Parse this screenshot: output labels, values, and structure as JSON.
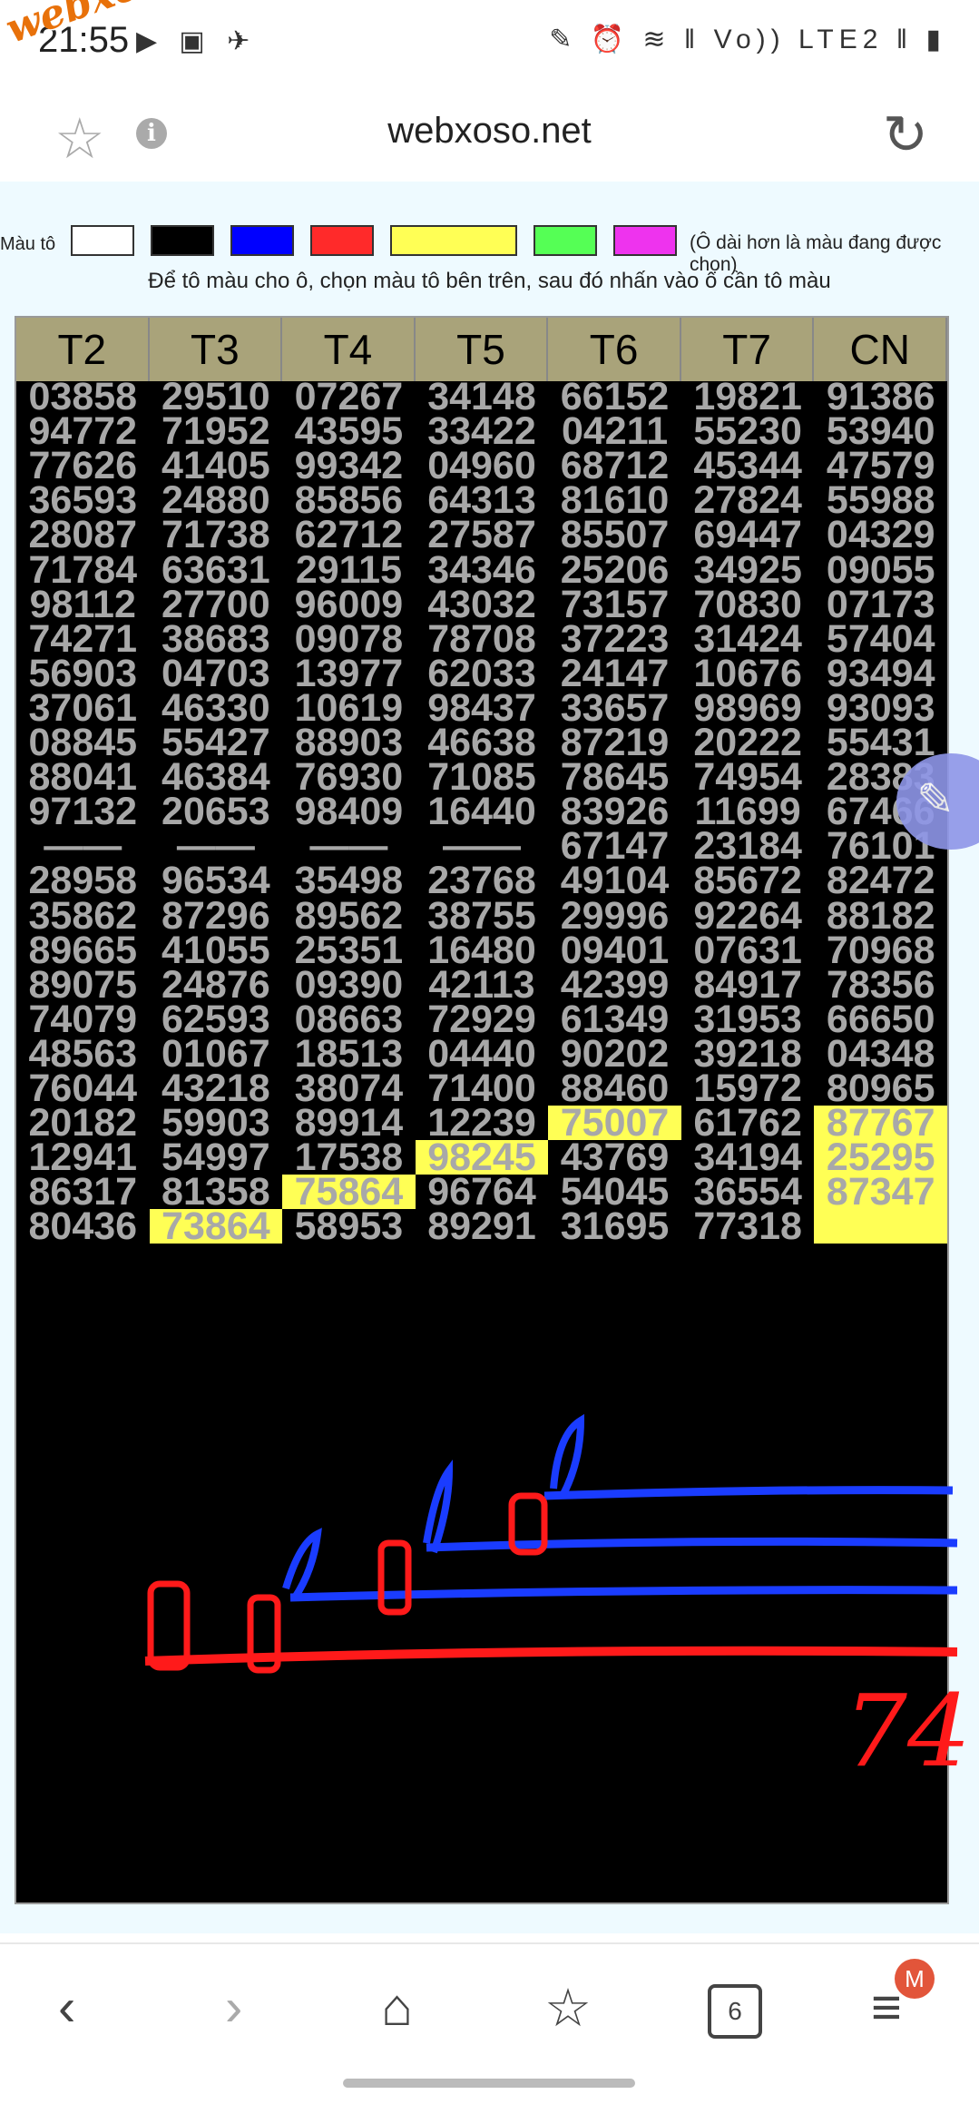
{
  "status_bar": {
    "time": "21:55",
    "left_icons": "▶ ▣ ✈",
    "right_icons": "✎ ⏰ ≋ ‖ Vo)) LTE2 ‖ ▮"
  },
  "watermark": "webxoso.net",
  "url_bar": {
    "url": "webxoso.net",
    "star_icon": "star-icon",
    "info_icon": "info-icon",
    "reload_icon": "reload-icon"
  },
  "palette": {
    "label": "Màu tô",
    "colors": [
      "#ffffff",
      "#000000",
      "#0000ff",
      "#ff2a2a",
      "#ffff55",
      "#55ff55",
      "#ee33ee"
    ],
    "note": "(Ô dài hơn là màu đang được chọn)"
  },
  "instruction": "Để tô màu cho ô, chọn màu tô bên trên, sau đó nhấn vào ô cần tô màu",
  "table": {
    "headers": [
      "T2",
      "T3",
      "T4",
      "T5",
      "T6",
      "T7",
      "CN"
    ],
    "rows": [
      [
        "03858",
        "29510",
        "07267",
        "34148",
        "66152",
        "19821",
        "91386"
      ],
      [
        "94772",
        "71952",
        "43595",
        "33422",
        "04211",
        "55230",
        "53940"
      ],
      [
        "77626",
        "41405",
        "99342",
        "04960",
        "68712",
        "45344",
        "47579"
      ],
      [
        "36593",
        "24880",
        "85856",
        "64313",
        "81610",
        "27824",
        "55988"
      ],
      [
        "28087",
        "71738",
        "62712",
        "27587",
        "85507",
        "69447",
        "04329"
      ],
      [
        "71784",
        "63631",
        "29115",
        "34346",
        "25206",
        "34925",
        "09055"
      ],
      [
        "98112",
        "27700",
        "96009",
        "43032",
        "73157",
        "70830",
        "07173"
      ],
      [
        "74271",
        "38683",
        "09078",
        "78708",
        "37223",
        "31424",
        "57404"
      ],
      [
        "56903",
        "04703",
        "13977",
        "62033",
        "24147",
        "10676",
        "93494"
      ],
      [
        "37061",
        "46330",
        "10619",
        "98437",
        "33657",
        "98969",
        "93093"
      ],
      [
        "08845",
        "55427",
        "88903",
        "46638",
        "87219",
        "20222",
        "55431"
      ],
      [
        "88041",
        "46384",
        "76930",
        "71085",
        "78645",
        "74954",
        "28383"
      ],
      [
        "97132",
        "20653",
        "98409",
        "16440",
        "83926",
        "11699",
        "67466"
      ],
      [
        "——",
        "——",
        "——",
        "——",
        "67147",
        "23184",
        "76101"
      ],
      [
        "28958",
        "96534",
        "35498",
        "23768",
        "49104",
        "85672",
        "82472"
      ],
      [
        "35862",
        "87296",
        "89562",
        "38755",
        "29996",
        "92264",
        "88182"
      ],
      [
        "89665",
        "41055",
        "25351",
        "16480",
        "09401",
        "07631",
        "70968"
      ],
      [
        "89075",
        "24876",
        "09390",
        "42113",
        "42399",
        "84917",
        "78356"
      ],
      [
        "74079",
        "62593",
        "08663",
        "72929",
        "61349",
        "31953",
        "66650"
      ],
      [
        "48563",
        "01067",
        "18513",
        "04440",
        "90202",
        "39218",
        "04348"
      ],
      [
        "76044",
        "43218",
        "38074",
        "71400",
        "88460",
        "15972",
        "80965"
      ],
      [
        "20182",
        "59903",
        "89914",
        "12239",
        "75007",
        "61762",
        "87767"
      ],
      [
        "12941",
        "54997",
        "17538",
        "98245",
        "43769",
        "34194",
        "25295"
      ],
      [
        "86317",
        "81358",
        "75864",
        "96764",
        "54045",
        "36554",
        "87347"
      ],
      [
        "80436",
        "73864",
        "58953",
        "89291",
        "31695",
        "77318",
        ""
      ]
    ],
    "highlighted": [
      [
        21,
        4
      ],
      [
        21,
        6
      ],
      [
        22,
        3
      ],
      [
        22,
        6
      ],
      [
        23,
        2
      ],
      [
        23,
        6
      ],
      [
        24,
        1
      ],
      [
        24,
        6
      ]
    ]
  },
  "handwritten_note": "74",
  "bottom_nav": {
    "back_icon": "back-icon",
    "forward_icon": "forward-icon",
    "home_icon": "home-icon",
    "bookmarks_icon": "bookmarks-icon",
    "tabs_count": "6",
    "menu_badge": "M"
  }
}
